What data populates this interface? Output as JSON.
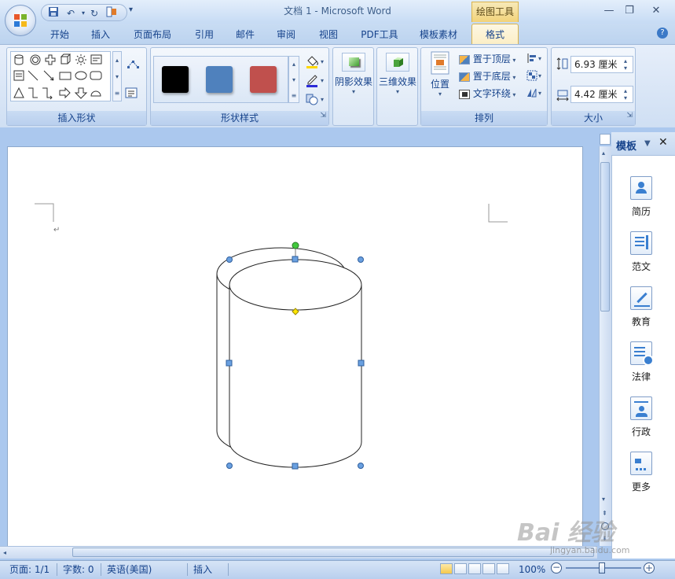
{
  "window": {
    "title": "文档 1 - Microsoft Word",
    "context_tab_title": "绘图工具",
    "controls": {
      "minimize": "—",
      "restore": "❐",
      "close": "✕"
    }
  },
  "quick_access": {
    "save_icon": "save-icon",
    "undo_icon": "undo-icon",
    "redo_icon": "redo-icon",
    "more": "▾"
  },
  "tabs": [
    {
      "label": "开始"
    },
    {
      "label": "插入"
    },
    {
      "label": "页面布局"
    },
    {
      "label": "引用"
    },
    {
      "label": "邮件"
    },
    {
      "label": "审阅"
    },
    {
      "label": "视图"
    },
    {
      "label": "PDF工具"
    },
    {
      "label": "模板素材"
    },
    {
      "label": "格式",
      "active": true
    }
  ],
  "ribbon": {
    "insert_shapes": {
      "label": "插入形状"
    },
    "shape_styles": {
      "label": "形状样式",
      "swatches": [
        "#000000",
        "#4f81bd",
        "#c0504d"
      ]
    },
    "shadow": {
      "label": "阴影效果"
    },
    "threed": {
      "label": "三维效果"
    },
    "arrange": {
      "label": "排列",
      "position": "位置",
      "bring_front": "置于顶层",
      "send_back": "置于底层",
      "text_wrap": "文字环绕"
    },
    "size": {
      "label": "大小",
      "height": "6.93 厘米",
      "width": "4.42 厘米"
    }
  },
  "side_panel": {
    "title": "模板",
    "items": [
      {
        "label": "简历",
        "icon": "resume-icon"
      },
      {
        "label": "范文",
        "icon": "essay-icon"
      },
      {
        "label": "教育",
        "icon": "education-icon"
      },
      {
        "label": "法律",
        "icon": "law-icon"
      },
      {
        "label": "行政",
        "icon": "admin-icon"
      },
      {
        "label": "更多",
        "icon": "more-icon"
      }
    ]
  },
  "status": {
    "page": "页面: 1/1",
    "words": "字数: 0",
    "language": "英语(美国)",
    "mode": "插入",
    "zoom": "100%"
  },
  "watermark": {
    "text": "Bai 经验",
    "url": "jingyan.baidu.com"
  },
  "doc": {
    "paragraph_mark": "↵"
  }
}
